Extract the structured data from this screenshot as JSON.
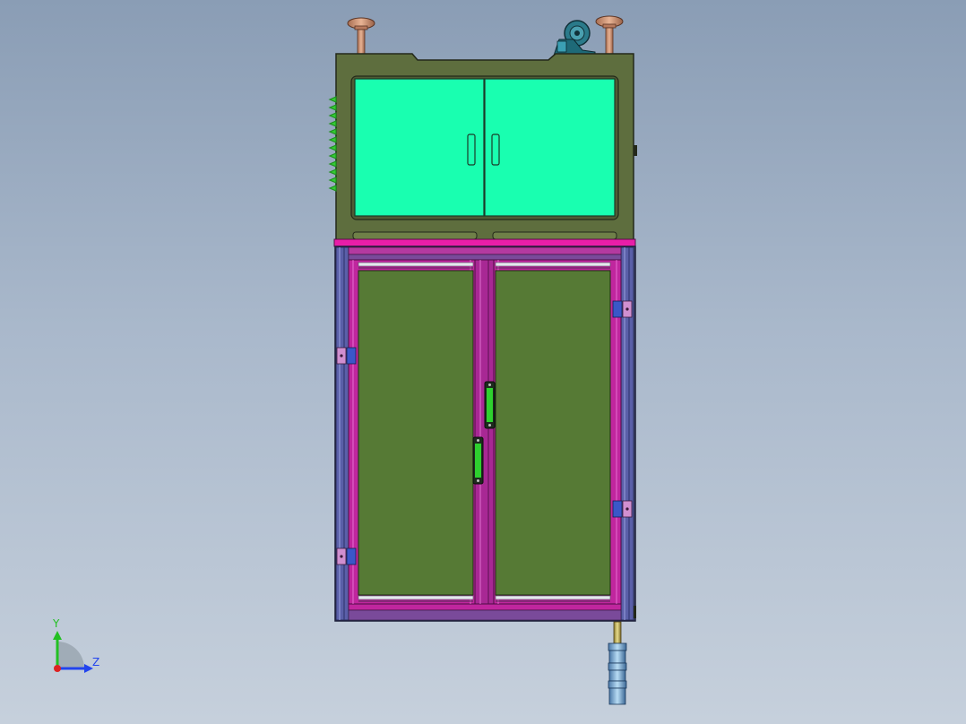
{
  "viewport": {
    "background_top": "#8a9db5",
    "background_bottom": "#c6d0dc"
  },
  "model": {
    "upper_cabinet": {
      "frame_color": "#5e6e3e",
      "door_color": "#19ffb0",
      "door_count": 2,
      "vent_fins": 12
    },
    "lower_cabinet": {
      "profile_color": "#c0269e",
      "frame_color": "#5a5fa8",
      "panel_color": "#567a35",
      "door_count": 2,
      "hinge_colors": [
        "#d08fd0",
        "#3a57c8"
      ],
      "handle_color": "#2ed02e"
    },
    "fixtures": {
      "leveling_feet": 2,
      "caster_wheels": 1,
      "foot_color": "#c89070",
      "caster_color": "#2a7a8a",
      "bottom_foot_color": "#7ab0dc"
    }
  },
  "triad": {
    "y_label": "Y",
    "z_label": "Z",
    "y_color": "#22c022",
    "z_color": "#2244ee",
    "origin_color": "#dd2222"
  }
}
